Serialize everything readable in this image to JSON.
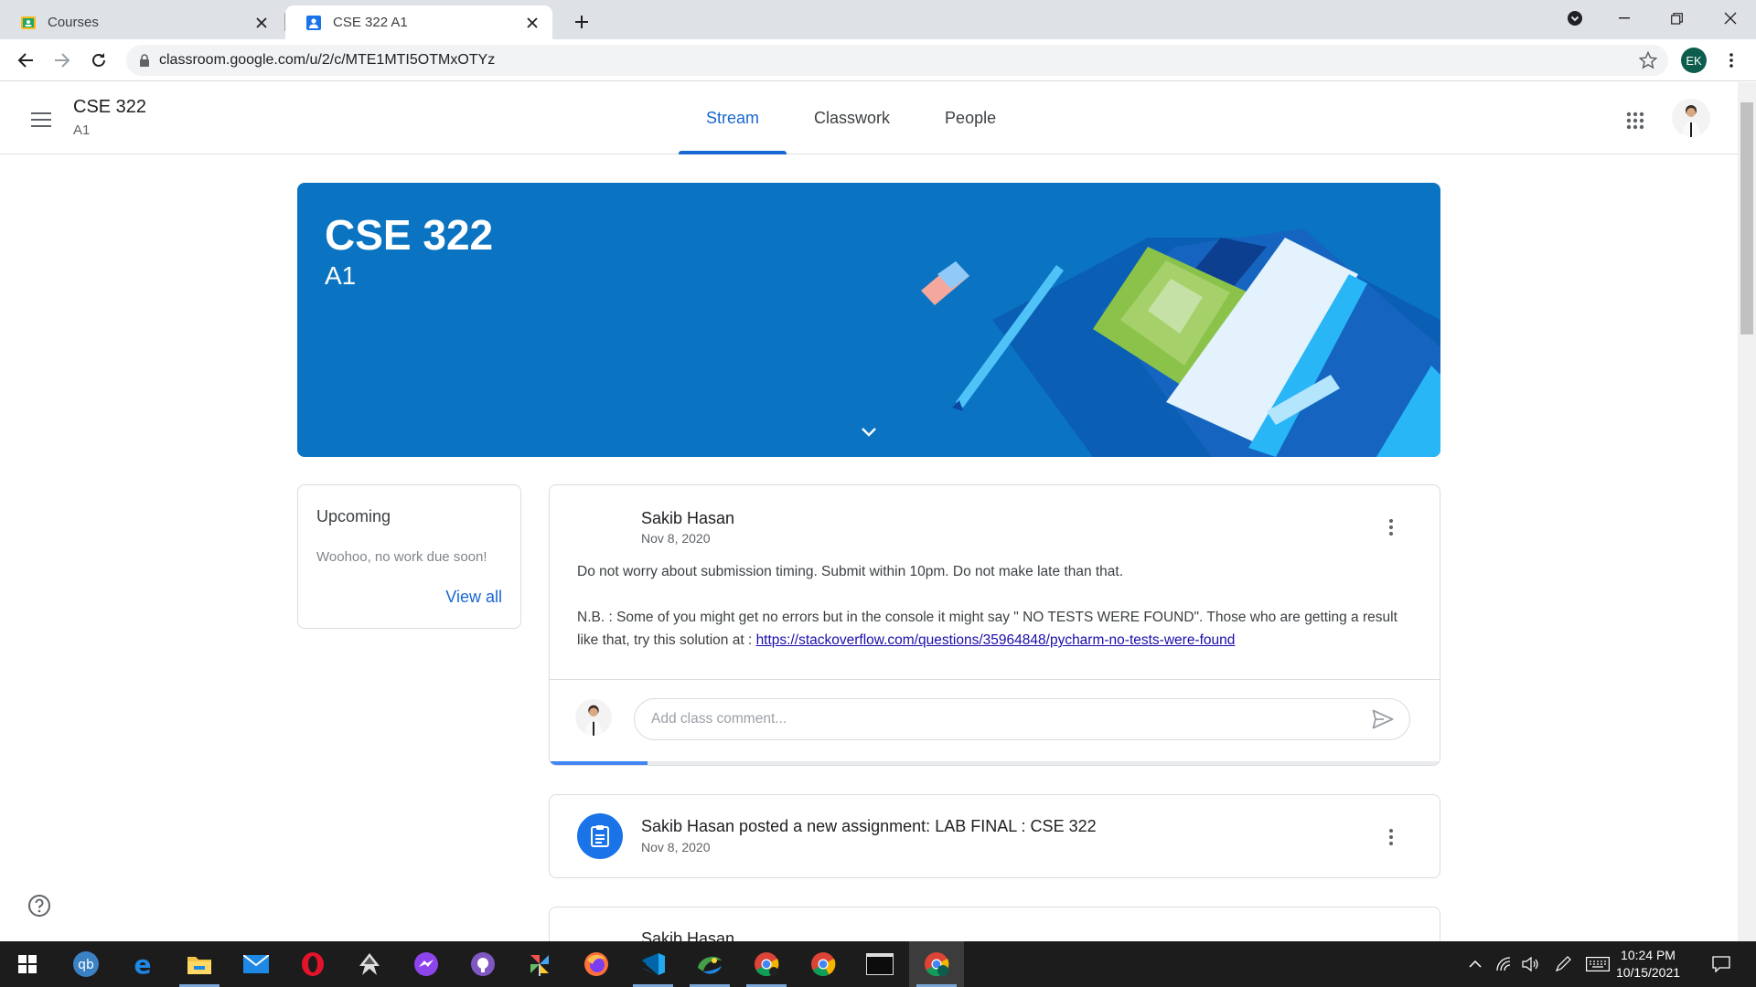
{
  "browser": {
    "tabs": [
      {
        "title": "Courses",
        "icon": "classroom-icon",
        "active": false
      },
      {
        "title": "CSE 322 A1",
        "icon": "classroom-people-icon",
        "active": true
      }
    ],
    "new_tab_icon": "plus-icon",
    "url": "classroom.google.com/u/2/c/MTE1MTI5OTMxOTYz",
    "profile_initials": "EK",
    "colors": {
      "tab_strip": "#dee1e6",
      "omnibox": "#f1f3f4",
      "profile": "#0d5d4e"
    }
  },
  "classroom": {
    "course_title": "CSE 322",
    "course_section": "A1",
    "nav_tabs": [
      {
        "label": "Stream",
        "selected": true
      },
      {
        "label": "Classwork",
        "selected": false
      },
      {
        "label": "People",
        "selected": false
      }
    ],
    "accent": "#1967d2"
  },
  "banner": {
    "title": "CSE 322",
    "subtitle": "A1",
    "color": "#0b74c2"
  },
  "upcoming": {
    "heading": "Upcoming",
    "text": "Woohoo, no work due soon!",
    "link": "View all"
  },
  "stream": {
    "post": {
      "author": "Sakib Hasan",
      "date": "Nov 8, 2020",
      "paragraph1": "Do not worry about submission timing. Submit within 10pm. Do not make late than that.",
      "paragraph2": "N.B. : Some of you might get no errors but in the console it might say \" NO TESTS WERE FOUND\". Those who are getting a result like that, try this solution at : ",
      "link": "https://stackoverflow.com/questions/35964848/pycharm-no-tests-were-found",
      "comment_placeholder": "Add class comment...",
      "load_progress": 0.11
    },
    "assignment": {
      "title": "Sakib Hasan posted a new assignment: LAB FINAL : CSE 322",
      "date": "Nov 8, 2020"
    },
    "partial_post": {
      "author": "Sakib Hasan"
    }
  },
  "taskbar": {
    "apps": [
      "windows-start-icon",
      "qbittorrent-icon",
      "edge-legacy-icon",
      "file-explorer-icon",
      "mail-icon",
      "opera-icon",
      "inkscape-icon",
      "messenger-icon",
      "github-desktop-icon",
      "pinwheel-app-icon",
      "firefox-icon",
      "vscode-icon",
      "python-ide-icon",
      "chrome-profile-icon",
      "chrome-icon",
      "terminal-icon",
      "chrome-ek-icon"
    ],
    "time": "10:24 PM",
    "date": "10/15/2021"
  }
}
